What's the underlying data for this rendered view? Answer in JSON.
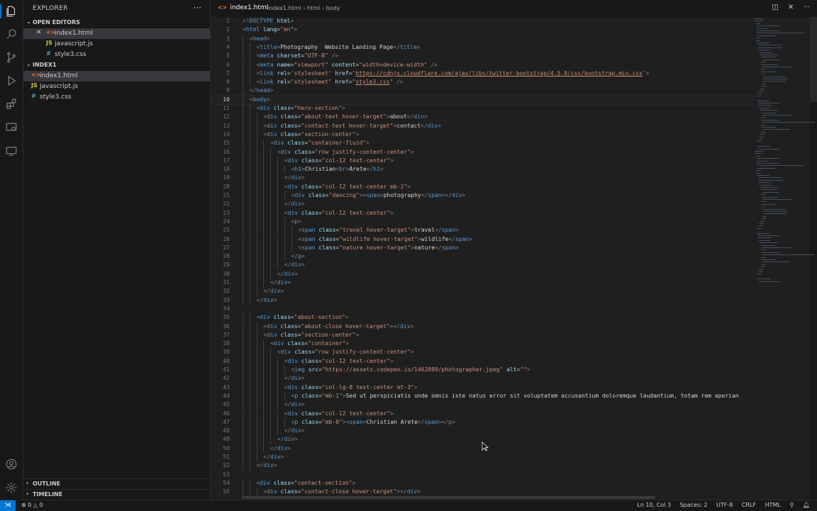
{
  "sidebar": {
    "title": "EXPLORER",
    "open_editors_label": "OPEN EDITORS",
    "open_editors": [
      {
        "name": "index1.html",
        "type": "html",
        "close": "✕"
      },
      {
        "name": "javascript.js",
        "type": "js"
      },
      {
        "name": "style3.css",
        "type": "css"
      }
    ],
    "folder_label": "INDEX1",
    "files": [
      {
        "name": "index1.html",
        "type": "html"
      },
      {
        "name": "javascript.js",
        "type": "js"
      },
      {
        "name": "style3.css",
        "type": "css"
      }
    ],
    "outline_label": "OUTLINE",
    "timeline_label": "TIMELINE"
  },
  "editor": {
    "tab_label": "index1.html",
    "breadcrumb": [
      "index1.html",
      "html",
      "body"
    ],
    "current_line": 10,
    "lines": [
      {
        "n": "1",
        "indent": 0,
        "html": "<span class='t'>&lt;!</span><span class='tg'>DOCTYPE</span> <span class='at'>html</span><span class='t'>&gt;</span>"
      },
      {
        "n": "2",
        "indent": 0,
        "html": "<span class='t'>&lt;</span><span class='tg'>html</span> <span class='at'>lang</span>=<span class='st'>\"en\"</span><span class='t'>&gt;</span>"
      },
      {
        "n": "3",
        "indent": 1,
        "html": "<span class='t'>&lt;</span><span class='tg'>head</span><span class='t'>&gt;</span>"
      },
      {
        "n": "4",
        "indent": 2,
        "html": "<span class='t'>&lt;</span><span class='tg'>title</span><span class='t'>&gt;</span><span class='tx'>Photography  Website Landing Page</span><span class='t'>&lt;/</span><span class='tg'>title</span><span class='t'>&gt;</span>"
      },
      {
        "n": "5",
        "indent": 2,
        "html": "<span class='t'>&lt;</span><span class='tg'>meta</span> <span class='at'>charset</span>=<span class='st'>\"UTF-8\"</span> <span class='t'>/&gt;</span>"
      },
      {
        "n": "6",
        "indent": 2,
        "html": "<span class='t'>&lt;</span><span class='tg'>meta</span> <span class='at'>name</span>=<span class='st'>\"viewport\"</span> <span class='at'>content</span>=<span class='st'>\"width=device-width\"</span> <span class='t'>/&gt;</span>"
      },
      {
        "n": "7",
        "indent": 2,
        "html": "<span class='t'>&lt;</span><span class='tg'>link</span> <span class='at'>rel</span>=<span class='st'>'stylesheet'</span> <span class='at'>href</span>=<span class='st'>'<span class=\"ul\">https://cdnjs.cloudflare.com/ajax/libs/twitter-bootstrap/4.5.0/css/bootstrap.min.css</span>'</span><span class='t'>&gt;</span>"
      },
      {
        "n": "8",
        "indent": 2,
        "html": "<span class='t'>&lt;</span><span class='tg'>link</span> <span class='at'>rel</span>=<span class='st'>\"stylesheet\"</span> <span class='at'>href</span>=<span class='st'>\"<span class=\"ul\">style3.css</span>\"</span> <span class='t'>/&gt;</span>"
      },
      {
        "n": "9",
        "indent": 1,
        "html": "<span class='t'>&lt;/</span><span class='tg'>head</span><span class='t'>&gt;</span>"
      },
      {
        "n": "10",
        "indent": 1,
        "html": "<span class='t'>&lt;</span><span class='tg'>body</span><span class='t'>&gt;</span>"
      },
      {
        "n": "11",
        "indent": 2,
        "html": "<span class='t'>&lt;</span><span class='tg'>div</span> <span class='at'>class</span>=<span class='st'>\"hero-section\"</span><span class='t'>&gt;</span>"
      },
      {
        "n": "12",
        "indent": 3,
        "html": "<span class='t'>&lt;</span><span class='tg'>div</span> <span class='at'>class</span>=<span class='st'>\"about-text hover-target\"</span><span class='t'>&gt;</span><span class='tx'>about</span><span class='t'>&lt;/</span><span class='tg'>div</span><span class='t'>&gt;</span>"
      },
      {
        "n": "13",
        "indent": 3,
        "html": "<span class='t'>&lt;</span><span class='tg'>div</span> <span class='at'>class</span>=<span class='st'>\"contact-text hover-target\"</span><span class='t'>&gt;</span><span class='tx'>contact</span><span class='t'>&lt;/</span><span class='tg'>div</span><span class='t'>&gt;</span>"
      },
      {
        "n": "14",
        "indent": 3,
        "html": "<span class='t'>&lt;</span><span class='tg'>div</span> <span class='at'>class</span>=<span class='st'>\"section-center\"</span><span class='t'>&gt;</span>"
      },
      {
        "n": "15",
        "indent": 4,
        "html": "<span class='t'>&lt;</span><span class='tg'>div</span> <span class='at'>class</span>=<span class='st'>\"container-fluid\"</span><span class='t'>&gt;</span>"
      },
      {
        "n": "16",
        "indent": 5,
        "html": "<span class='t'>&lt;</span><span class='tg'>div</span> <span class='at'>class</span>=<span class='st'>\"row justify-content-center\"</span><span class='t'>&gt;</span>"
      },
      {
        "n": "17",
        "indent": 6,
        "html": "<span class='t'>&lt;</span><span class='tg'>div</span> <span class='at'>class</span>=<span class='st'>\"col-12 text-center\"</span><span class='t'>&gt;</span>"
      },
      {
        "n": "18",
        "indent": 7,
        "html": "<span class='t'>&lt;</span><span class='tg'>h1</span><span class='t'>&gt;</span><span class='tx'>Christian</span><span class='t'>&lt;</span><span class='tg'>br</span><span class='t'>&gt;</span><span class='tx'>Arete</span><span class='t'>&lt;/</span><span class='tg'>h1</span><span class='t'>&gt;</span>"
      },
      {
        "n": "19",
        "indent": 6,
        "html": "<span class='t'>&lt;/</span><span class='tg'>div</span><span class='t'>&gt;</span>"
      },
      {
        "n": "20",
        "indent": 6,
        "html": "<span class='t'>&lt;</span><span class='tg'>div</span> <span class='at'>class</span>=<span class='st'>\"col-12 text-center mb-2\"</span><span class='t'>&gt;</span>"
      },
      {
        "n": "21",
        "indent": 7,
        "html": "<span class='t'>&lt;</span><span class='tg'>div</span> <span class='at'>class</span>=<span class='st'>\"dancing\"</span><span class='t'>&gt;&lt;</span><span class='tg'>span</span><span class='t'>&gt;</span><span class='tx'>photography</span><span class='t'>&lt;/</span><span class='tg'>span</span><span class='t'>&gt;&lt;/</span><span class='tg'>div</span><span class='t'>&gt;</span>"
      },
      {
        "n": "22",
        "indent": 6,
        "html": "<span class='t'>&lt;/</span><span class='tg'>div</span><span class='t'>&gt;</span>"
      },
      {
        "n": "23",
        "indent": 6,
        "html": "<span class='t'>&lt;</span><span class='tg'>div</span> <span class='at'>class</span>=<span class='st'>\"col-12 text-center\"</span><span class='t'>&gt;</span>"
      },
      {
        "n": "24",
        "indent": 7,
        "html": "<span class='t'>&lt;</span><span class='tg'>p</span><span class='t'>&gt;</span>"
      },
      {
        "n": "25",
        "indent": 8,
        "html": "<span class='t'>&lt;</span><span class='tg'>span</span> <span class='at'>class</span>=<span class='st'>\"travel hover-target\"</span><span class='t'>&gt;</span><span class='tx'>travel</span><span class='t'>&lt;/</span><span class='tg'>span</span><span class='t'>&gt;</span>"
      },
      {
        "n": "26",
        "indent": 8,
        "html": "<span class='t'>&lt;</span><span class='tg'>span</span> <span class='at'>class</span>=<span class='st'>\"wildlife hover-target\"</span><span class='t'>&gt;</span><span class='tx'>wildlife</span><span class='t'>&lt;/</span><span class='tg'>span</span><span class='t'>&gt;</span>"
      },
      {
        "n": "27",
        "indent": 8,
        "html": "<span class='t'>&lt;</span><span class='tg'>span</span> <span class='at'>class</span>=<span class='st'>\"nature hover-target\"</span><span class='t'>&gt;</span><span class='tx'>nature</span><span class='t'>&lt;/</span><span class='tg'>span</span><span class='t'>&gt;</span>"
      },
      {
        "n": "28",
        "indent": 7,
        "html": "<span class='t'>&lt;/</span><span class='tg'>p</span><span class='t'>&gt;</span>"
      },
      {
        "n": "29",
        "indent": 6,
        "html": "<span class='t'>&lt;/</span><span class='tg'>div</span><span class='t'>&gt;</span>"
      },
      {
        "n": "30",
        "indent": 5,
        "html": "<span class='t'>&lt;/</span><span class='tg'>div</span><span class='t'>&gt;</span>"
      },
      {
        "n": "31",
        "indent": 4,
        "html": "<span class='t'>&lt;/</span><span class='tg'>div</span><span class='t'>&gt;</span>"
      },
      {
        "n": "32",
        "indent": 3,
        "html": "<span class='t'>&lt;/</span><span class='tg'>div</span><span class='t'>&gt;</span>"
      },
      {
        "n": "33",
        "indent": 2,
        "html": "<span class='t'>&lt;/</span><span class='tg'>div</span><span class='t'>&gt;</span>"
      },
      {
        "n": "34",
        "indent": 0,
        "html": ""
      },
      {
        "n": "35",
        "indent": 2,
        "html": "<span class='t'>&lt;</span><span class='tg'>div</span> <span class='at'>class</span>=<span class='st'>\"about-section\"</span><span class='t'>&gt;</span>"
      },
      {
        "n": "36",
        "indent": 3,
        "html": "<span class='t'>&lt;</span><span class='tg'>div</span> <span class='at'>class</span>=<span class='st'>\"about-close hover-target\"</span><span class='t'>&gt;&lt;/</span><span class='tg'>div</span><span class='t'>&gt;</span>"
      },
      {
        "n": "37",
        "indent": 3,
        "html": "<span class='t'>&lt;</span><span class='tg'>div</span> <span class='at'>class</span>=<span class='st'>\"section-center\"</span><span class='t'>&gt;</span>"
      },
      {
        "n": "38",
        "indent": 4,
        "html": "<span class='t'>&lt;</span><span class='tg'>div</span> <span class='at'>class</span>=<span class='st'>\"container\"</span><span class='t'>&gt;</span>"
      },
      {
        "n": "39",
        "indent": 5,
        "html": "<span class='t'>&lt;</span><span class='tg'>div</span> <span class='at'>class</span>=<span class='st'>\"row justify-content-center\"</span><span class='t'>&gt;</span>"
      },
      {
        "n": "40",
        "indent": 6,
        "html": "<span class='t'>&lt;</span><span class='tg'>div</span> <span class='at'>class</span>=<span class='st'>\"col-12 text-center\"</span><span class='t'>&gt;</span>"
      },
      {
        "n": "41",
        "indent": 7,
        "html": "<span class='t'>&lt;</span><span class='tg'>img</span> <span class='at'>src</span>=<span class='st'>\"https://assets.codepen.io/1462889/photographer.jpeg\"</span> <span class='at'>alt</span>=<span class='st'>\"\"</span><span class='t'>&gt;</span>"
      },
      {
        "n": "42",
        "indent": 6,
        "html": "<span class='t'>&lt;/</span><span class='tg'>div</span><span class='t'>&gt;</span>"
      },
      {
        "n": "43",
        "indent": 6,
        "html": "<span class='t'>&lt;</span><span class='tg'>div</span> <span class='at'>class</span>=<span class='st'>\"col-lg-8 text-center mt-3\"</span><span class='t'>&gt;</span>"
      },
      {
        "n": "44",
        "indent": 7,
        "html": "<span class='t'>&lt;</span><span class='tg'>p</span> <span class='at'>class</span>=<span class='st'>\"mb-1\"</span><span class='t'>&gt;</span><span class='tx'>Sed ut perspiciatis unde omnis iste natus error sit voluptatem accusantium doloremque laudantium, totam rem aperian</span>"
      },
      {
        "n": "45",
        "indent": 6,
        "html": "<span class='t'>&lt;/</span><span class='tg'>div</span><span class='t'>&gt;</span>"
      },
      {
        "n": "46",
        "indent": 6,
        "html": "<span class='t'>&lt;</span><span class='tg'>div</span> <span class='at'>class</span>=<span class='st'>\"col-12 text-center\"</span><span class='t'>&gt;</span>"
      },
      {
        "n": "47",
        "indent": 7,
        "html": "<span class='t'>&lt;</span><span class='tg'>p</span> <span class='at'>class</span>=<span class='st'>\"mb-0\"</span><span class='t'>&gt;&lt;</span><span class='tg'>span</span><span class='t'>&gt;</span><span class='tx'>Christian Arete</span><span class='t'>&lt;/</span><span class='tg'>span</span><span class='t'>&gt;&lt;/</span><span class='tg'>p</span><span class='t'>&gt;</span>"
      },
      {
        "n": "48",
        "indent": 6,
        "html": "<span class='t'>&lt;/</span><span class='tg'>div</span><span class='t'>&gt;</span>"
      },
      {
        "n": "49",
        "indent": 5,
        "html": "<span class='t'>&lt;/</span><span class='tg'>div</span><span class='t'>&gt;</span>"
      },
      {
        "n": "50",
        "indent": 4,
        "html": "<span class='t'>&lt;/</span><span class='tg'>div</span><span class='t'>&gt;</span>"
      },
      {
        "n": "51",
        "indent": 3,
        "html": "<span class='t'>&lt;/</span><span class='tg'>div</span><span class='t'>&gt;</span>"
      },
      {
        "n": "52",
        "indent": 2,
        "html": "<span class='t'>&lt;/</span><span class='tg'>div</span><span class='t'>&gt;</span>"
      },
      {
        "n": "53",
        "indent": 0,
        "html": ""
      },
      {
        "n": "54",
        "indent": 2,
        "html": "<span class='t'>&lt;</span><span class='tg'>div</span> <span class='at'>class</span>=<span class='st'>\"contact-section\"</span><span class='t'>&gt;</span>"
      },
      {
        "n": "55",
        "indent": 3,
        "html": "<span class='t'>&lt;</span><span class='tg'>div</span> <span class='at'>class</span>=<span class='st'>\"contact-close hover-target\"</span><span class='t'>&gt;&lt;/</span><span class='tg'>div</span><span class='t'>&gt;</span>"
      }
    ]
  },
  "statusbar": {
    "errors": "0",
    "warnings": "0",
    "position": "Ln 10, Col 3",
    "spaces": "Spaces: 2",
    "encoding": "UTF-8",
    "eol": "CRLF",
    "language": "HTML"
  },
  "icons": {
    "activity": [
      "files-icon",
      "search-icon",
      "source-control-icon",
      "run-debug-icon",
      "extensions-icon",
      "remote-explorer-icon",
      "testing-icon",
      "account-icon",
      "settings-gear-icon"
    ]
  },
  "colors": {
    "accent": "#0078d4",
    "html_icon": "#e37933",
    "js_icon": "#cbcb41",
    "css_icon": "#519aba"
  }
}
